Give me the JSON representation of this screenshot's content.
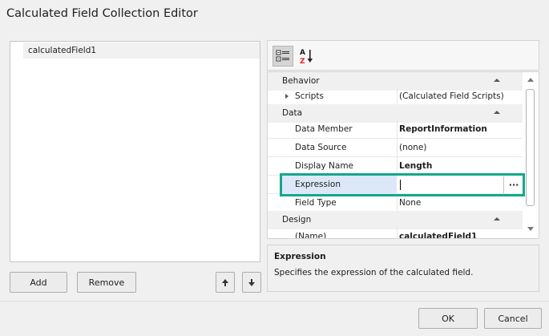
{
  "window": {
    "title": "Calculated Field Collection Editor"
  },
  "list": {
    "items": [
      "calculatedField1"
    ]
  },
  "buttons": {
    "add": "Add",
    "remove": "Remove",
    "ok": "OK",
    "cancel": "Cancel"
  },
  "toolbar": {
    "categorized_icon": "categorized-icon",
    "alphabetical_icon": "sort-az-icon"
  },
  "properties": {
    "behavior": {
      "label": "Behavior"
    },
    "scripts": {
      "label": "Scripts",
      "value": "(Calculated Field Scripts)"
    },
    "data": {
      "label": "Data"
    },
    "data_member": {
      "label": "Data Member",
      "value": "ReportInformation"
    },
    "data_source": {
      "label": "Data Source",
      "value": "(none)"
    },
    "display_name": {
      "label": "Display Name",
      "value": "Length"
    },
    "expression": {
      "label": "Expression",
      "value": "",
      "button": "···"
    },
    "field_type": {
      "label": "Field Type",
      "value": "None"
    },
    "design": {
      "label": "Design"
    },
    "name": {
      "label": "(Name)",
      "value": "calculatedField1"
    }
  },
  "description": {
    "title": "Expression",
    "text": "Specifies the expression of the calculated field."
  },
  "colors": {
    "highlight": "#13a88a",
    "selected_row": "#dce7f7"
  }
}
